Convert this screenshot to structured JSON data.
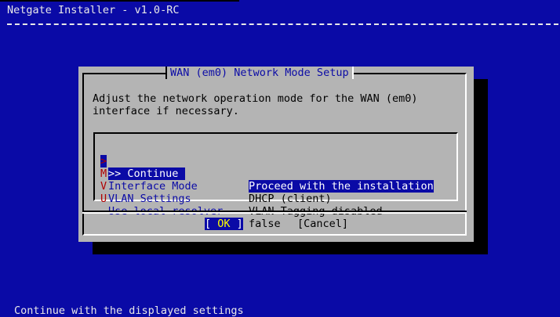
{
  "backtitle": "Netgate Installer - v1.0-RC",
  "dialog": {
    "title": "WAN (em0) Network Mode Setup",
    "prompt_line1": "Adjust the network operation mode for the WAN (em0)",
    "prompt_line2": "interface if necessary.",
    "menu": [
      {
        "key": ">",
        "name": ">> Continue",
        "desc": "Proceed with the installation",
        "selected": true
      },
      {
        "key": "M",
        "name": "Interface Mode",
        "desc": "DHCP (client)",
        "selected": false
      },
      {
        "key": "V",
        "name": "VLAN Settings",
        "desc": "VLAN Tagging disabled",
        "selected": false
      },
      {
        "key": "U",
        "name": "Use local resolver",
        "desc": "false",
        "selected": false
      }
    ],
    "ok_left": "[ ",
    "ok_label": "OK",
    "ok_right": " ]",
    "cancel_label": "[Cancel]"
  },
  "status_line": "Continue with the displayed settings",
  "colors": {
    "background": "#0a0aa6",
    "dialog": "#b4b4b4",
    "highlight": "#0a0aa6",
    "hotkey": "#b00000"
  }
}
